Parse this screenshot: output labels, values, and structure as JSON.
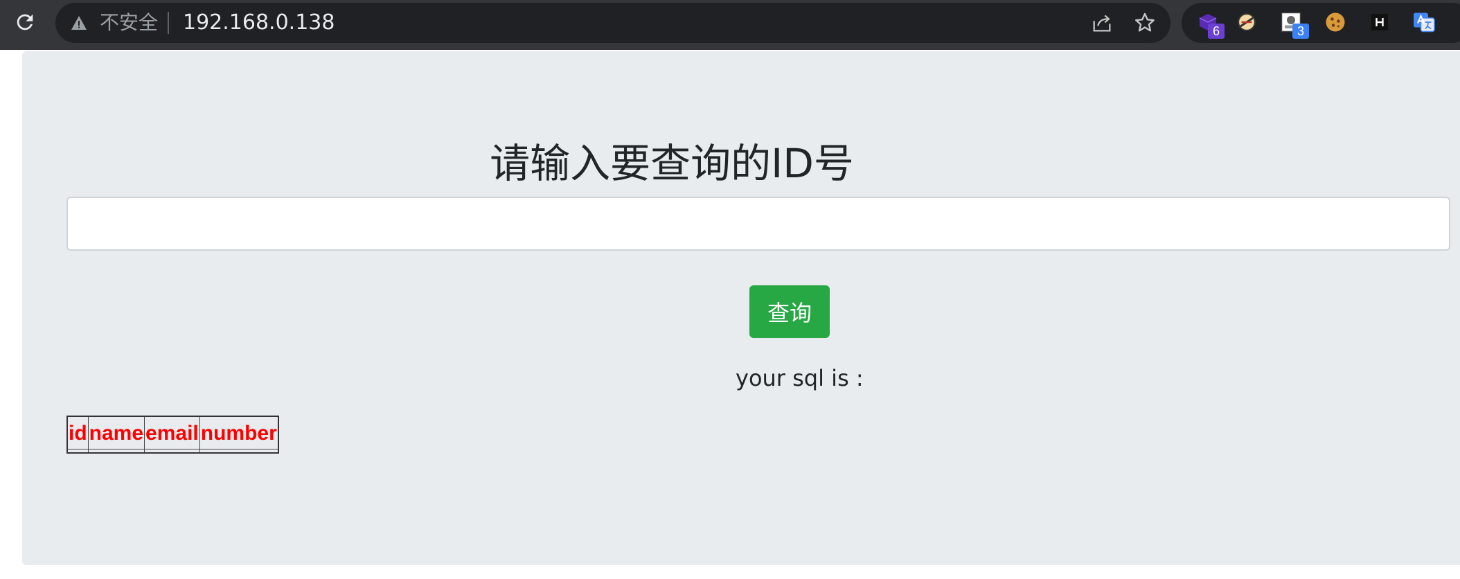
{
  "browser": {
    "security_label": "不安全",
    "url": "192.168.0.138",
    "extensions": [
      {
        "name": "purple-cube-extension",
        "badge": "6",
        "badge_color": "#6b3fd1"
      },
      {
        "name": "hamburger-extension",
        "badge": ""
      },
      {
        "name": "screenshot-extension",
        "badge": "3",
        "badge_color": "#3b82f6"
      },
      {
        "name": "cookie-extension",
        "badge": ""
      },
      {
        "name": "h-extension",
        "badge": ""
      },
      {
        "name": "translate-extension",
        "badge": ""
      }
    ]
  },
  "page": {
    "title": "请输入要查询的ID号",
    "input_value": "",
    "query_button_label": "查询",
    "sql_label": "your sql is :",
    "table_headers": [
      "id",
      "name",
      "email",
      "number"
    ]
  },
  "colors": {
    "toolbar": "#35363a",
    "omnibox": "#202124",
    "jumbotron": "#e9ecef",
    "button": "#28a745",
    "header_text": "#ff0000"
  }
}
